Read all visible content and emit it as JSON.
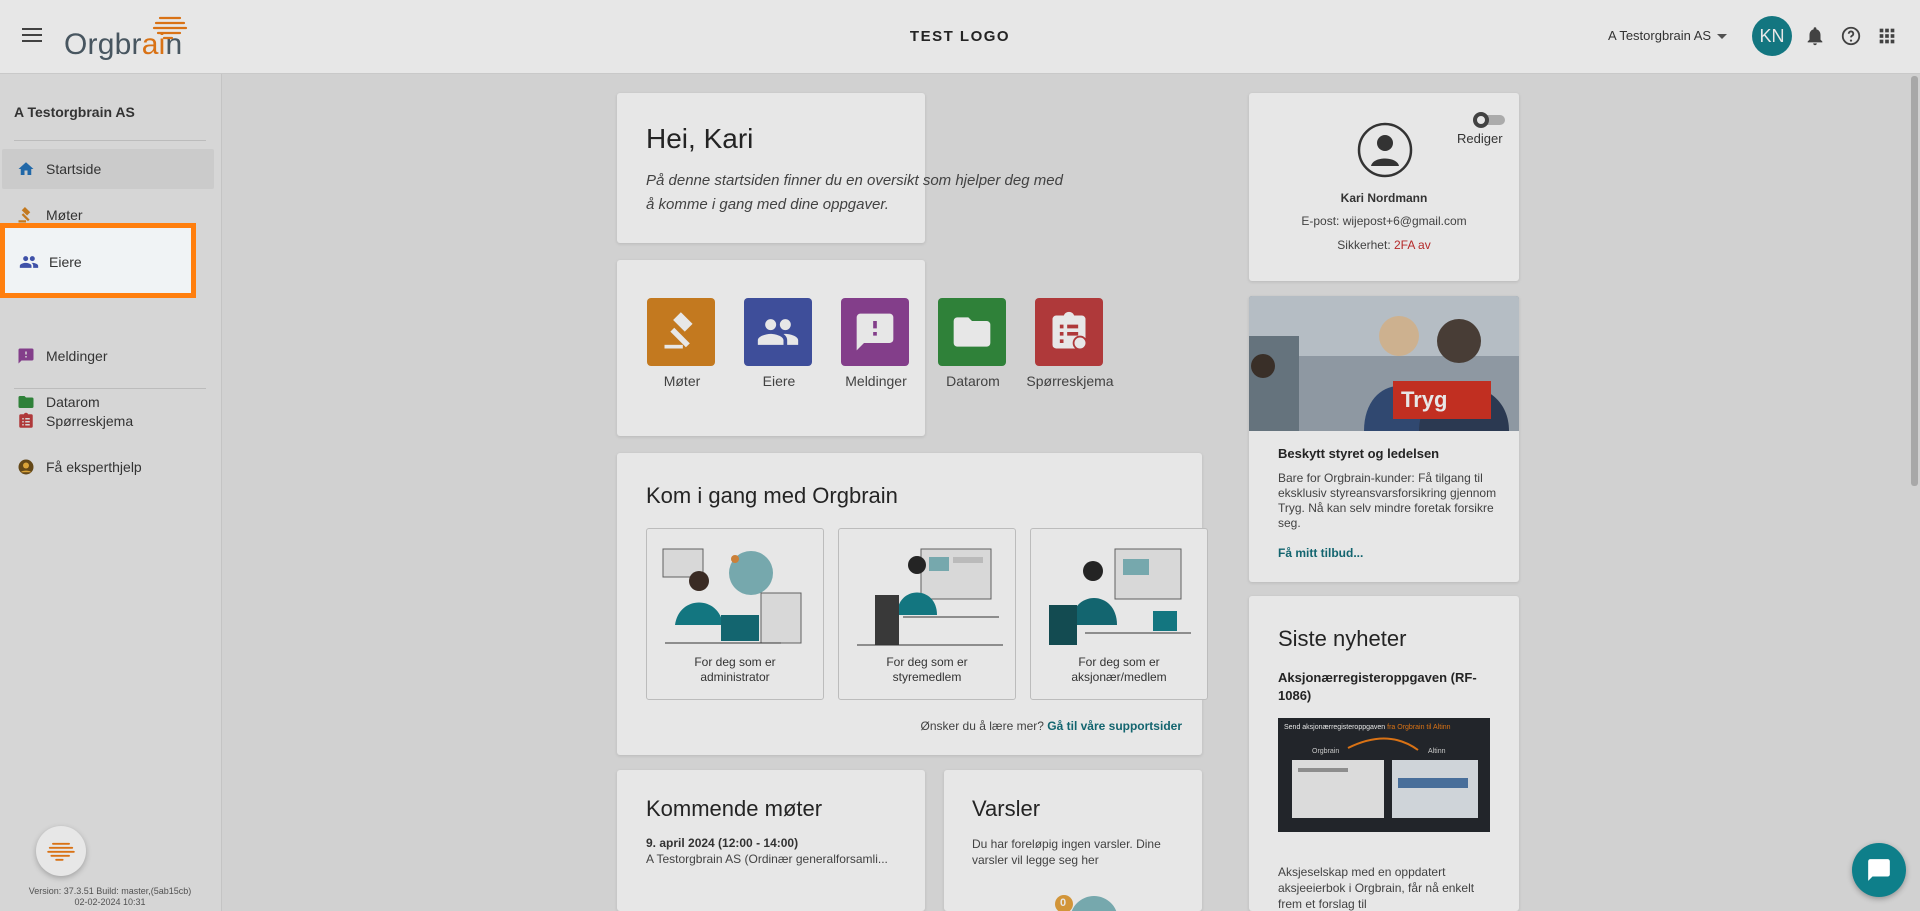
{
  "header": {
    "logo_text_a": "Orgbr",
    "logo_text_b": "ai",
    "logo_text_c": "n",
    "center_logo": "TEST LOGO",
    "org_name": "A Testorgbrain AS",
    "avatar_initials": "KN"
  },
  "sidebar": {
    "org_name": "A Testorgbrain AS",
    "items": [
      {
        "label": "Startside",
        "icon": "home-icon"
      },
      {
        "label": "Møter",
        "icon": "gavel-icon"
      },
      {
        "label": "Eiere",
        "icon": "people-icon"
      },
      {
        "label": "Meldinger",
        "icon": "message-icon"
      },
      {
        "label": "Datarom",
        "icon": "folder-icon"
      },
      {
        "label": "Spørreskjema",
        "icon": "clipboard-icon"
      },
      {
        "label": "Få eksperthjelp",
        "icon": "expert-icon"
      }
    ],
    "version_line1": "Version: 37.3.51 Build: master,(5ab15cb)",
    "version_line2": "02-02-2024 10:31"
  },
  "welcome": {
    "title": "Hei, Kari",
    "text": "På denne startsiden finner du en oversikt som hjelper deg med å komme i gang med dine oppgaver."
  },
  "apps": [
    {
      "label": "Møter",
      "color": "#d6821c",
      "icon": "gavel-icon"
    },
    {
      "label": "Eiere",
      "color": "#3f51a8",
      "icon": "people-icon"
    },
    {
      "label": "Meldinger",
      "color": "#8e3f96",
      "icon": "message-icon"
    },
    {
      "label": "Datarom",
      "color": "#2e8b3a",
      "icon": "folder-icon"
    },
    {
      "label": "Spørreskjema",
      "color": "#c0393b",
      "icon": "clipboard-icon"
    }
  ],
  "getting_started": {
    "title": "Kom i gang med Orgbrain",
    "roles": [
      {
        "line1": "For deg som er",
        "line2": "administrator"
      },
      {
        "line1": "For deg som er",
        "line2": "styremedlem"
      },
      {
        "line1": "For deg som er",
        "line2": "aksjonær/medlem"
      }
    ],
    "learn_text": "Ønsker du å lære mer?",
    "learn_link": "Gå til våre supportsider"
  },
  "meetings": {
    "title": "Kommende møter",
    "date": "9. april 2024 (12:00 - 14:00)",
    "name": "A Testorgbrain AS (Ordinær generalforsamli..."
  },
  "alerts": {
    "title": "Varsler",
    "text": "Du har foreløpig ingen varsler. Dine varsler vil legge seg her",
    "badge": "0"
  },
  "profile": {
    "edit_label": "Rediger",
    "name": "Kari Nordmann",
    "email": "E-post: wijepost+6@gmail.com",
    "security_label": "Sikkerhet:",
    "security_value": "2FA av"
  },
  "tryg": {
    "logo": "Tryg",
    "title": "Beskytt styret og ledelsen",
    "text": "Bare for Orgbrain-kunder: Få tilgang til eksklusiv styreansvarsforsikring gjennom Tryg. Nå kan selv mindre foretak forsikre seg.",
    "link": "Få mitt tilbud..."
  },
  "news": {
    "title": "Siste nyheter",
    "headline": "Aksjonærregisteroppgaven (RF-1086)",
    "img_caption_a": "Send aksjonærregisteroppgaven",
    "img_caption_b": "fra Orgbrain til Altinn",
    "img_label_left": "Orgbrain",
    "img_label_right": "Altinn",
    "text": "Aksjeselskap med en oppdatert aksjeeierbok i Orgbrain, får nå enkelt frem et forslag til"
  }
}
